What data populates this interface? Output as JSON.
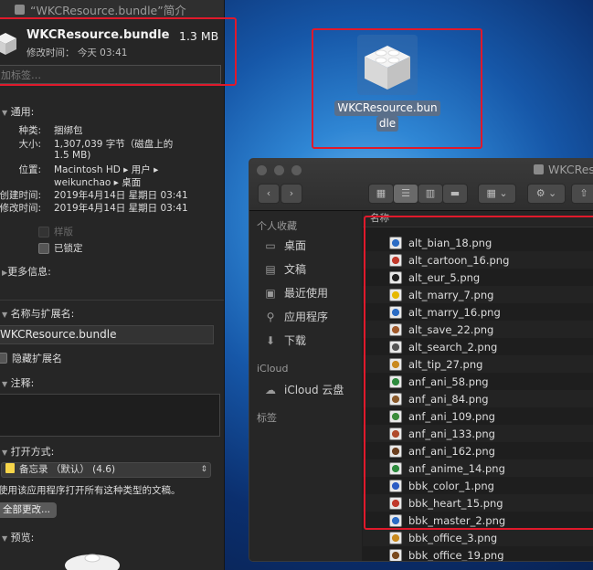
{
  "info": {
    "window_title": "“WKCResource.bundle”简介",
    "file_name": "WKCResource.bundle",
    "file_size": "1.3 MB",
    "modified_line": "修改时间：  今天 03:41",
    "tags_placeholder": "加标签…",
    "general_header": "通用:",
    "kind_label": "种类:",
    "kind_value": "捆绑包",
    "size_label": "大小:",
    "size_value_1": "1,307,039 字节（磁盘上的",
    "size_value_2": "1.5 MB)",
    "where_label": "位置:",
    "where_value_1": "Macintosh HD ▸ 用户 ▸",
    "where_value_2": "weikunchao ▸ 桌面",
    "created_label": "创建时间:",
    "created_value": "2019年4月14日 星期日 03:41",
    "modified_label": "修改时间:",
    "modified_value": "2019年4月14日 星期日 03:41",
    "stationery_label": "样版",
    "locked_label": "已锁定",
    "more_info_header": "更多信息:",
    "name_ext_header": "名称与扩展名:",
    "name_value": "WKCResource.bundle",
    "hide_ext_label": "隐藏扩展名",
    "comments_header": "注释:",
    "open_with_header": "打开方式:",
    "open_with_value": "备忘录 （默认）  (4.6)",
    "open_with_note": "使用该应用程序打开所有这种类型的文稿。",
    "change_all_button": "全部更改...",
    "preview_header": "预览:"
  },
  "desktop": {
    "bundle_label_1": "WKCResource.bun",
    "bundle_label_2": "dle"
  },
  "finder": {
    "title": "WKCRes",
    "sidebar": {
      "favorites_header": "个人收藏",
      "items": [
        {
          "label": "桌面",
          "icon": "desktop-icon"
        },
        {
          "label": "文稿",
          "icon": "documents-icon"
        },
        {
          "label": "最近使用",
          "icon": "recents-icon"
        },
        {
          "label": "应用程序",
          "icon": "applications-icon"
        },
        {
          "label": "下载",
          "icon": "downloads-icon"
        }
      ],
      "icloud_header": "iCloud",
      "icloud_item": "iCloud 云盘",
      "tags_header": "标签"
    },
    "column_header": "名称",
    "files": [
      "alt_bian_18.png",
      "alt_cartoon_16.png",
      "alt_eur_5.png",
      "alt_marry_7.png",
      "alt_marry_16.png",
      "alt_save_22.png",
      "alt_search_2.png",
      "alt_tip_27.png",
      "anf_ani_58.png",
      "anf_ani_84.png",
      "anf_ani_109.png",
      "anf_ani_133.png",
      "anf_ani_162.png",
      "anf_anime_14.png",
      "bbk_color_1.png",
      "bbk_heart_15.png",
      "bbk_master_2.png",
      "bbk_office_3.png",
      "bbk_office_19.png"
    ]
  },
  "colors": {
    "highlight": "#e0192b",
    "panel": "#262626",
    "desktop_accent": "#2f86d4"
  }
}
